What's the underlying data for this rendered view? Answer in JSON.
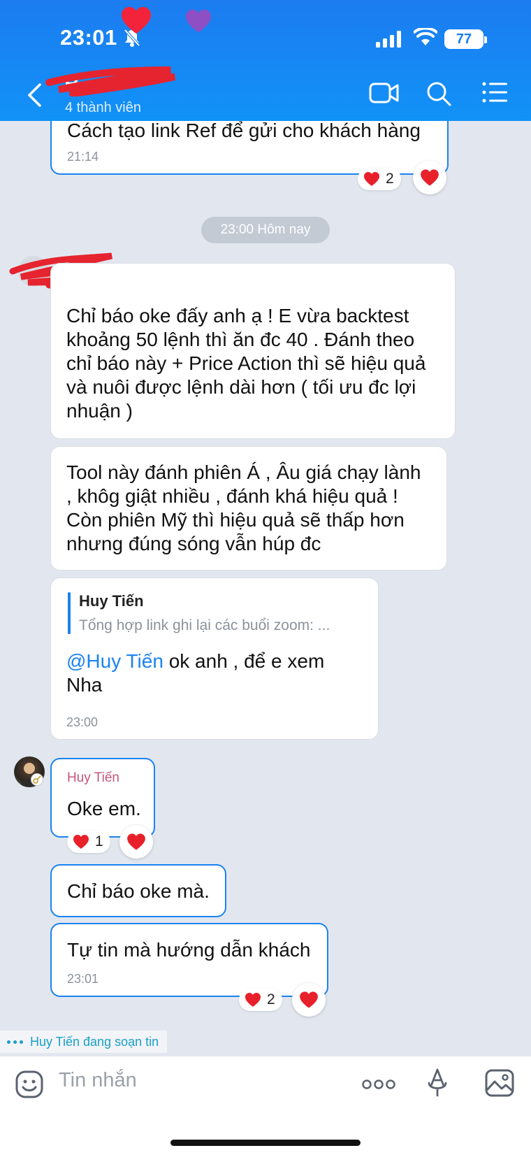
{
  "status_bar": {
    "time": "23:01",
    "battery": "77"
  },
  "header": {
    "group_name": "B",
    "member_count": "4 thành viên"
  },
  "messages": {
    "prev": {
      "text": "Cách tạo link Ref để gửi cho khách hàng",
      "time": "21:14",
      "reaction_count": "2"
    },
    "date_chip": "23:00 Hôm nay",
    "m1": {
      "text": "Chỉ báo oke đấy anh ạ ! E vừa backtest khoảng 50 lệnh thì ăn đc 40 . Đánh theo chỉ báo này + Price Action thì sẽ hiệu quả và nuôi được lệnh dài hơn ( tối ưu đc lợi nhuận )"
    },
    "m2": {
      "text": "Tool này đánh phiên Á , Âu giá chạy lành , khôg giật nhiều , đánh khá hiệu quả ! Còn phiên Mỹ thì hiệu quả sẽ thấp hơn nhưng đúng sóng vẫn húp đc"
    },
    "m3": {
      "quote_name": "Huy Tiến",
      "quote_text": "Tổng hợp link ghi lại các buổi zoom: ...",
      "mention": "@Huy Tiến",
      "text_after": " ok anh , để e xem",
      "text_line2": "Nha",
      "time": "23:00"
    },
    "m4": {
      "sender": "Huy Tiến",
      "text": "Oke em.",
      "reaction_count": "1"
    },
    "m5": {
      "text": "Chỉ báo oke mà."
    },
    "m6": {
      "text": "Tự tin mà hướng dẫn khách",
      "time": "23:01",
      "reaction_count": "2"
    }
  },
  "typing_indicator": "Huy Tiến đang soạn tin",
  "input": {
    "placeholder": "Tin nhắn"
  },
  "colors": {
    "header": "#1c7cf0",
    "accent": "#1a83f0",
    "heart": "#e8202a",
    "sender_name": "#c4567b"
  }
}
